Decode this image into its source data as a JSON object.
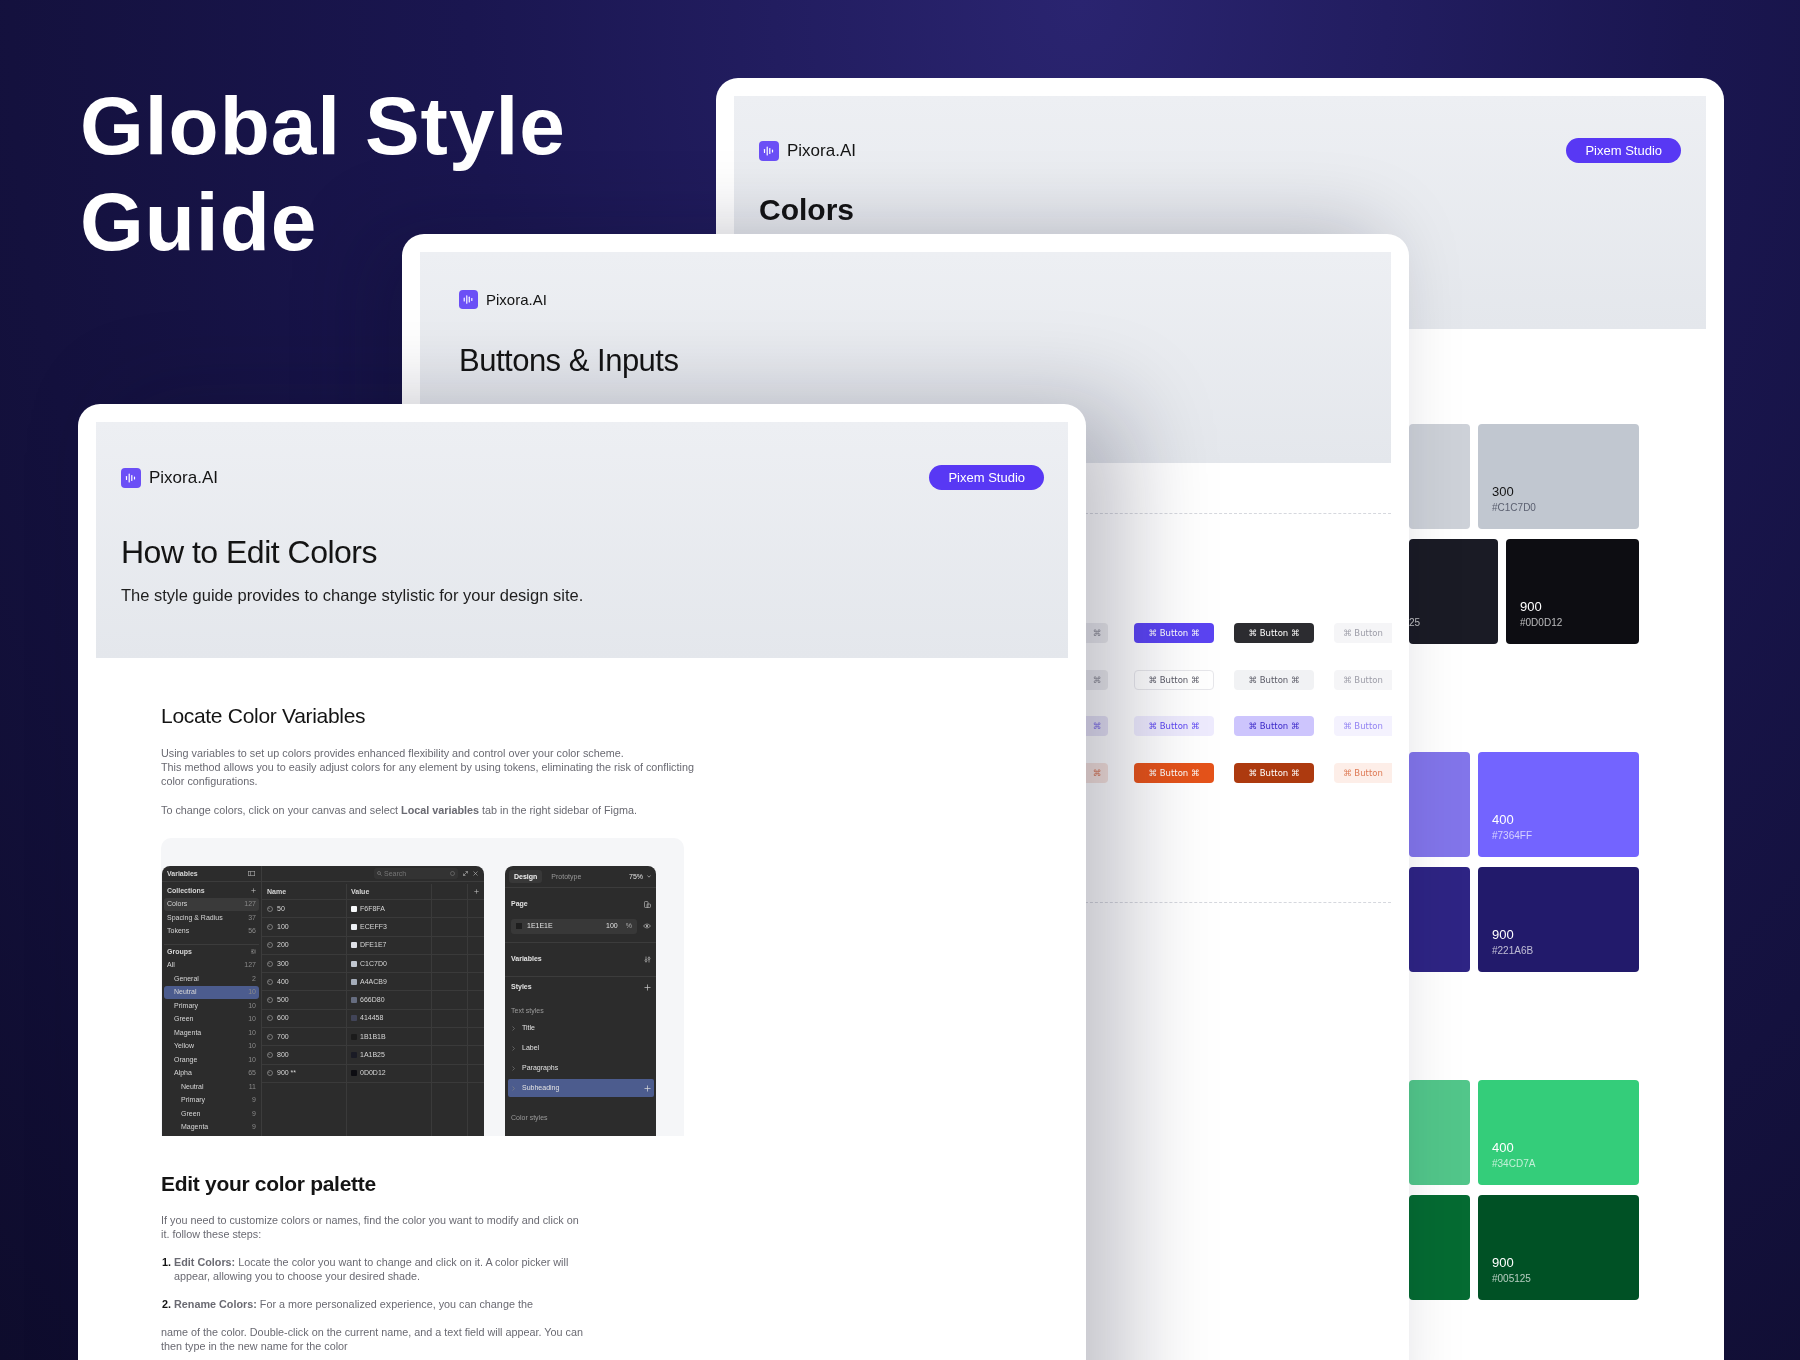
{
  "headline": "Global Style Guide",
  "colors_page": {
    "brand": "Pixora.AI",
    "cta": "Pixem Studio",
    "heading": "Colors",
    "swatch_rows": [
      {
        "partial": {
          "color": "#cdd1d8"
        },
        "main": {
          "label": "300",
          "code": "#C1C7D0",
          "color": "#c1c7d0"
        }
      },
      {
        "partial": {
          "color": "#1a1b25",
          "text": "25"
        },
        "main": {
          "label": "900",
          "code": "#0D0D12",
          "color": "#0d0d12"
        }
      },
      {
        "partial": {
          "color": "#8275ea"
        },
        "main": {
          "label": "400",
          "code": "#7364FF",
          "color": "#7364ff"
        }
      },
      {
        "partial": {
          "color": "#2e2484"
        },
        "main": {
          "label": "900",
          "code": "#221A6B",
          "color": "#221a6b"
        }
      },
      {
        "partial": {
          "color": "#52c68a"
        },
        "main": {
          "label": "400",
          "code": "#34CD7A",
          "color": "#34cd7a"
        }
      },
      {
        "partial": {
          "color": "#056b32"
        },
        "main": {
          "label": "900",
          "code": "#005125",
          "color": "#005125"
        }
      }
    ]
  },
  "buttons_page": {
    "brand": "Pixora.AI",
    "heading": "Buttons & Inputs",
    "button_rows": [
      [
        {
          "text": "⌘",
          "kind": "ghost"
        },
        {
          "text": "⌘ Button ⌘",
          "kind": "primary"
        },
        {
          "text": "⌘ Button ⌘",
          "kind": "dark"
        },
        {
          "text": "⌘ Button",
          "kind": "disabled"
        }
      ],
      [
        {
          "text": "⌘",
          "kind": "ghost"
        },
        {
          "text": "⌘ Button ⌘",
          "kind": "outline"
        },
        {
          "text": "⌘ Button ⌘",
          "kind": "light"
        },
        {
          "text": "⌘ Button",
          "kind": "disabled"
        }
      ],
      [
        {
          "text": "⌘",
          "kind": "soft-ghost"
        },
        {
          "text": "⌘ Button ⌘",
          "kind": "soft"
        },
        {
          "text": "⌘ Button ⌘",
          "kind": "tint"
        },
        {
          "text": "⌘ Button",
          "kind": "soft-disabled"
        }
      ],
      [
        {
          "text": "⌘",
          "kind": "danger-ghost"
        },
        {
          "text": "⌘ Button ⌘",
          "kind": "danger"
        },
        {
          "text": "⌘ Button ⌘",
          "kind": "danger-dark"
        },
        {
          "text": "⌘ Button",
          "kind": "danger-disabled"
        }
      ]
    ]
  },
  "guide_page": {
    "brand": "Pixora.AI",
    "cta": "Pixem Studio",
    "heading": "How to Edit Colors",
    "subtitle": "The style guide provides to change stylistic for your design site.",
    "locate": {
      "heading": "Locate Color Variables",
      "paragraph_lines": [
        "Using variables to set up colors provides enhanced flexibility and control over your color scheme.",
        "This method allows you to easily adjust colors for any element by using tokens, eliminating the risk of conflicting color configurations."
      ],
      "instruction": "To change colors, click on your canvas and select **Local variables** tab in the right sidebar of Figma."
    },
    "screenshot": {
      "variables_panel": {
        "title": "Variables",
        "search_placeholder": "Search",
        "collections_label": "Collections",
        "collections": [
          {
            "name": "Colors",
            "count": "127",
            "selected": true
          },
          {
            "name": "Spacing & Radius",
            "count": "37",
            "selected": false
          },
          {
            "name": "Tokens",
            "count": "56",
            "selected": false
          }
        ],
        "groups_label": "Groups",
        "groups": [
          {
            "name": "All",
            "count": "127",
            "selected": false,
            "children": [
              {
                "name": "General",
                "count": "2",
                "selected": false
              },
              {
                "name": "Neutral",
                "count": "10",
                "selected": true
              },
              {
                "name": "Primary",
                "count": "10",
                "selected": false
              },
              {
                "name": "Green",
                "count": "10",
                "selected": false
              },
              {
                "name": "Magenta",
                "count": "10",
                "selected": false
              },
              {
                "name": "Yellow",
                "count": "10",
                "selected": false
              },
              {
                "name": "Orange",
                "count": "10",
                "selected": false
              },
              {
                "name": "Alpha",
                "count": "65",
                "selected": false,
                "children": [
                  {
                    "name": "Neutral",
                    "count": "11",
                    "selected": false
                  },
                  {
                    "name": "Primary",
                    "count": "9",
                    "selected": false
                  },
                  {
                    "name": "Green",
                    "count": "9",
                    "selected": false
                  },
                  {
                    "name": "Magenta",
                    "count": "9",
                    "selected": false
                  }
                ]
              }
            ]
          }
        ],
        "columns": [
          "Name",
          "Value"
        ],
        "rows": [
          {
            "name": "50",
            "value": "F6F8FA",
            "color": "#f6f8fa"
          },
          {
            "name": "100",
            "value": "ECEFF3",
            "color": "#eceff3"
          },
          {
            "name": "200",
            "value": "DFE1E7",
            "color": "#dfe1e7"
          },
          {
            "name": "300",
            "value": "C1C7D0",
            "color": "#c1c7d0"
          },
          {
            "name": "400",
            "value": "A4ACB9",
            "color": "#a4acb9"
          },
          {
            "name": "500",
            "value": "666D80",
            "color": "#666d80"
          },
          {
            "name": "600",
            "value": "414458",
            "color": "#414458"
          },
          {
            "name": "700",
            "value": "1B1B1B",
            "color": "#1b1b1b"
          },
          {
            "name": "800",
            "value": "1A1B25",
            "color": "#1a1b25"
          },
          {
            "name": "900 **",
            "value": "0D0D12",
            "color": "#0d0d12"
          }
        ]
      },
      "design_panel": {
        "tabs": [
          {
            "label": "Design",
            "selected": true
          },
          {
            "label": "Prototype",
            "selected": false
          }
        ],
        "zoom": "75%",
        "page_label": "Page",
        "fill": {
          "hex": "1E1E1E",
          "opacity": "100",
          "unit": "%"
        },
        "variables_label": "Variables",
        "styles_label": "Styles",
        "text_styles_label": "Text styles",
        "text_styles": [
          {
            "name": "Title",
            "selected": false
          },
          {
            "name": "Label",
            "selected": false
          },
          {
            "name": "Paragraphs",
            "selected": false
          },
          {
            "name": "Subheading",
            "selected": true
          }
        ],
        "color_styles_label": "Color styles"
      }
    },
    "edit": {
      "heading": "Edit your color palette",
      "intro": "If you need to customize colors or names, find the color you want to modify and click on it. follow these steps:",
      "steps": [
        {
          "number": "1.",
          "text": "**Edit Colors:** Locate the color you want to change and click on it. A color picker will appear, allowing you to choose your desired shade."
        },
        {
          "number": "2.",
          "text": "**Rename Colors:** For a more personalized experience, you can change the"
        }
      ],
      "after_lines": [
        "name of the color. Double-click on the current name, and a text field will appear. You can",
        "then type in the new name for the color"
      ]
    }
  }
}
